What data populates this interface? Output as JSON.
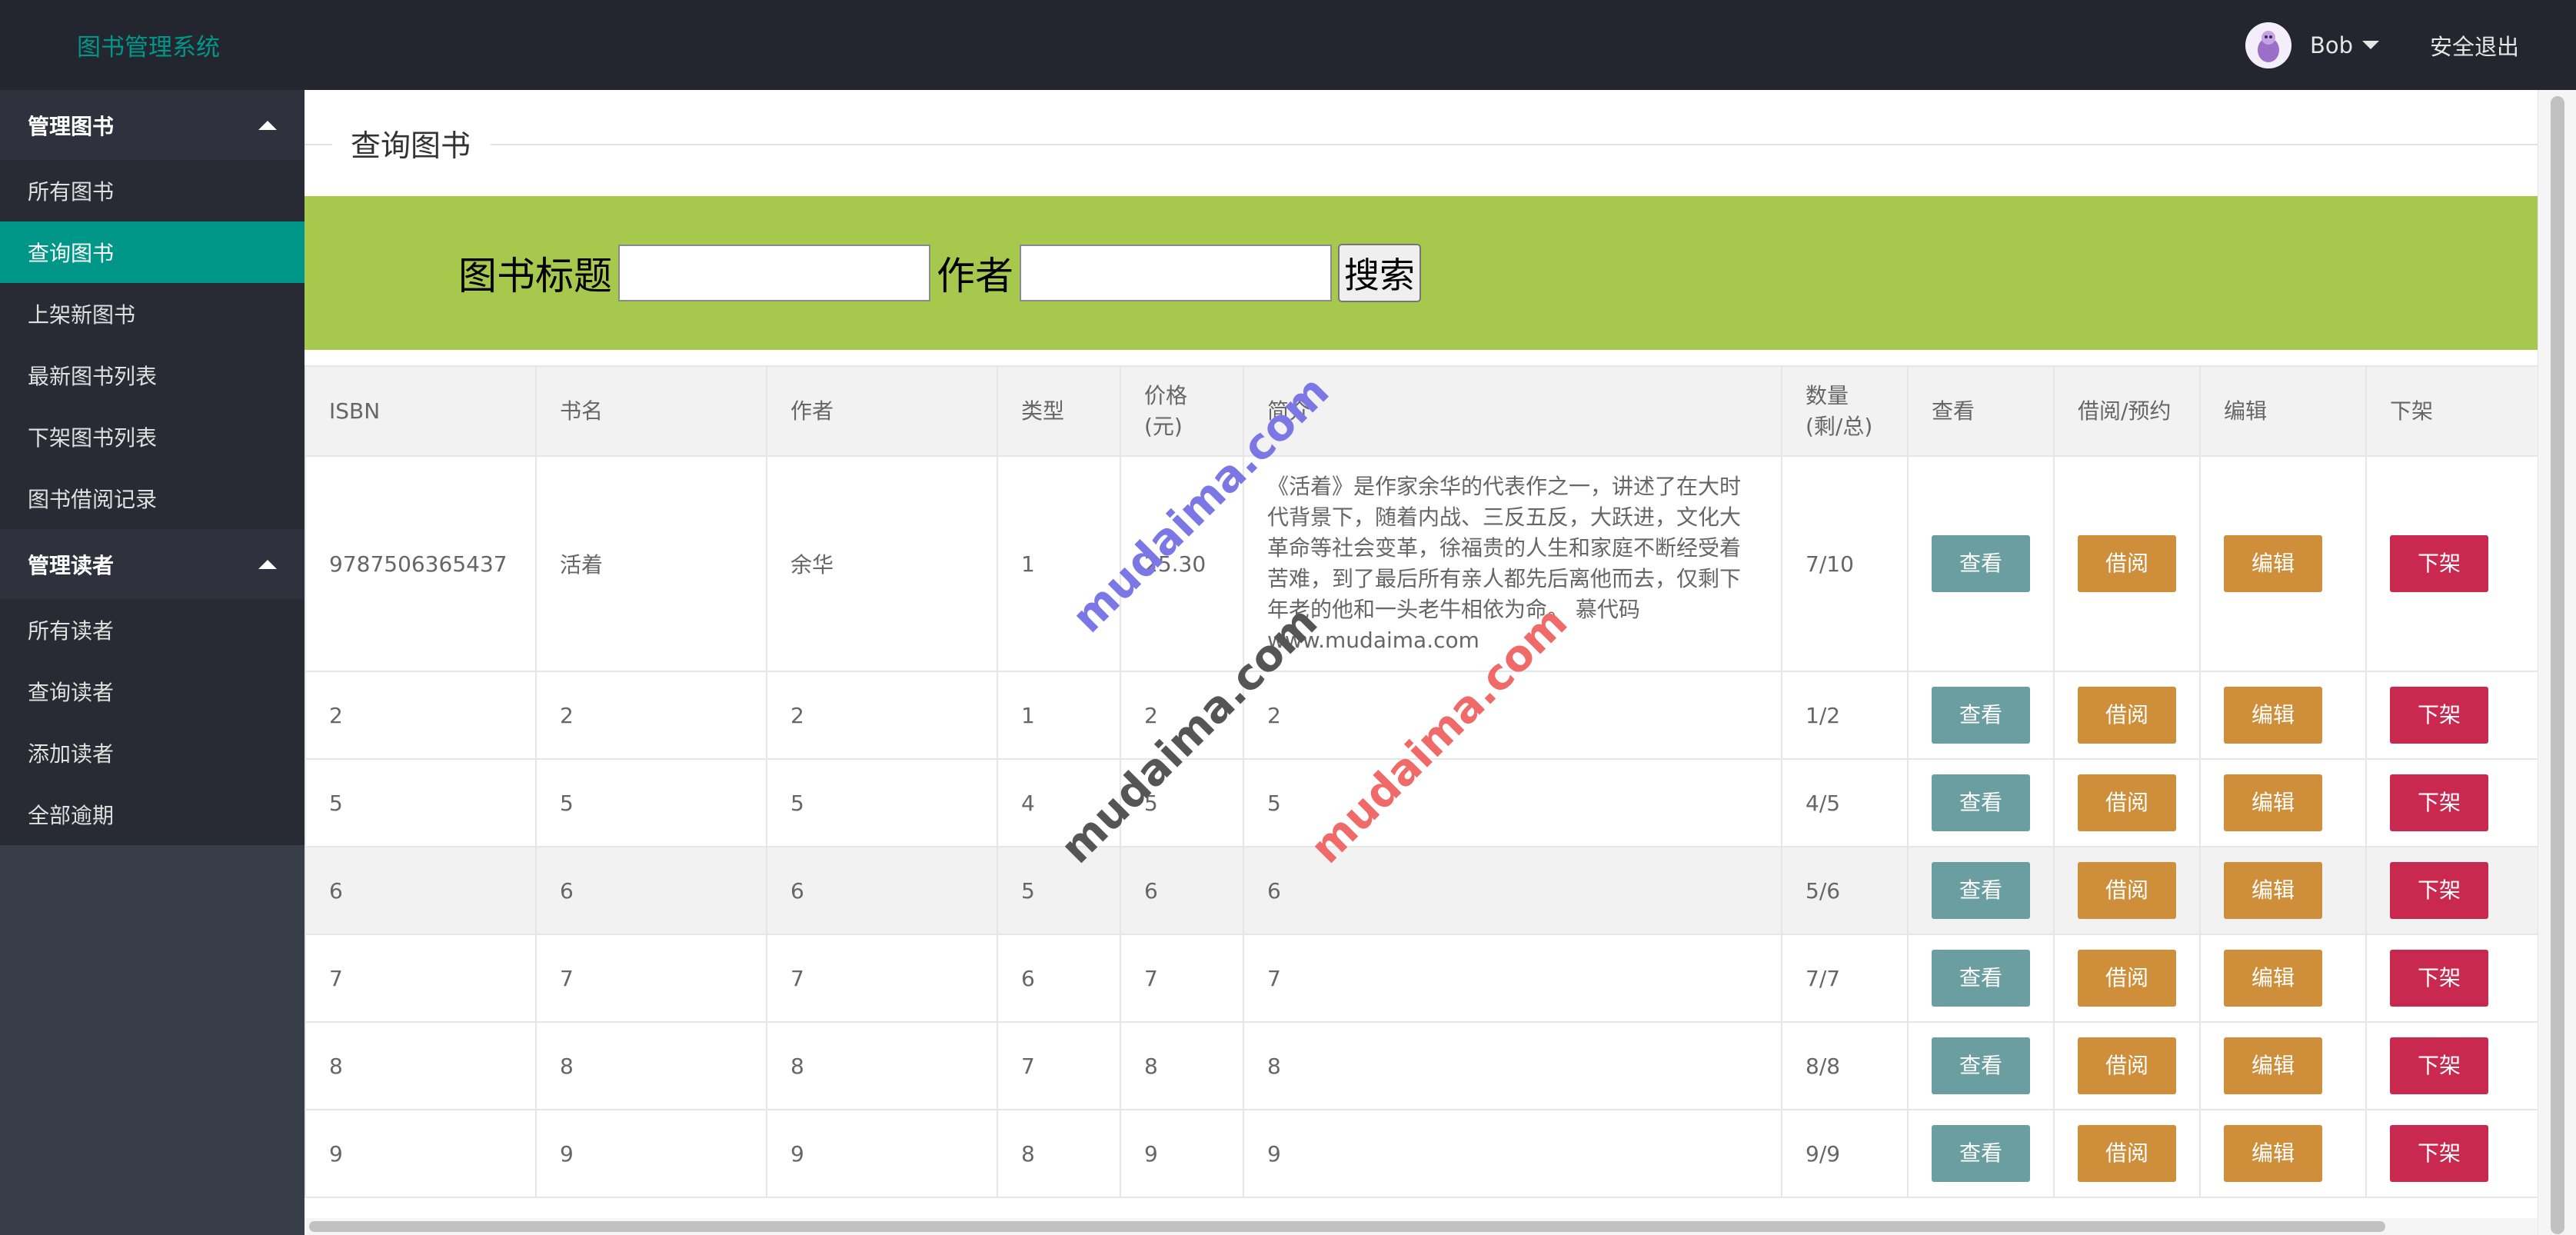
{
  "app": {
    "title": "图书管理系统"
  },
  "header": {
    "user_name": "Bob",
    "logout_label": "安全退出"
  },
  "sidebar": {
    "groups": [
      {
        "label": "管理图书",
        "items": [
          "所有图书",
          "查询图书",
          "上架新图书",
          "最新图书列表",
          "下架图书列表",
          "图书借阅记录"
        ]
      },
      {
        "label": "管理读者",
        "items": [
          "所有读者",
          "查询读者",
          "添加读者",
          "全部逾期"
        ]
      }
    ],
    "active_item": "查询图书"
  },
  "main": {
    "section_title": "查询图书",
    "search": {
      "title_label": "图书标题",
      "title_value": "",
      "author_label": "作者",
      "author_value": "",
      "button_label": "搜索"
    },
    "table": {
      "headers": [
        "ISBN",
        "书名",
        "作者",
        "类型",
        "价格(元)",
        "简介",
        "数量(剩/总)",
        "查看",
        "借阅/预约",
        "编辑",
        "下架"
      ],
      "action_labels": {
        "view": "查看",
        "borrow": "借阅",
        "edit": "编辑",
        "remove": "下架"
      },
      "rows": [
        {
          "isbn": "9787506365437",
          "name": "活着",
          "author": "余华",
          "type": "1",
          "price": "25.30",
          "intro": "《活着》是作家余华的代表作之一，讲述了在大时代背景下，随着内战、三反五反，大跃进，文化大革命等社会变革，徐福贵的人生和家庭不断经受着苦难，到了最后所有亲人都先后离他而去，仅剩下年老的他和一头老牛相依为命。 慕代码www.mudaima.com",
          "count": "7/10"
        },
        {
          "isbn": "2",
          "name": "2",
          "author": "2",
          "type": "1",
          "price": "2",
          "intro": "2",
          "count": "1/2"
        },
        {
          "isbn": "5",
          "name": "5",
          "author": "5",
          "type": "4",
          "price": "5",
          "intro": "5",
          "count": "4/5"
        },
        {
          "isbn": "6",
          "name": "6",
          "author": "6",
          "type": "5",
          "price": "6",
          "intro": "6",
          "count": "5/6"
        },
        {
          "isbn": "7",
          "name": "7",
          "author": "7",
          "type": "6",
          "price": "7",
          "intro": "7",
          "count": "7/7"
        },
        {
          "isbn": "8",
          "name": "8",
          "author": "8",
          "type": "7",
          "price": "8",
          "intro": "8",
          "count": "8/8"
        },
        {
          "isbn": "9",
          "name": "9",
          "author": "9",
          "type": "8",
          "price": "9",
          "intro": "9",
          "count": "9/9"
        }
      ]
    }
  },
  "watermarks": [
    {
      "text": "mudaima.com",
      "color": "#7b78e6"
    },
    {
      "text": "mudaima.com",
      "color": "#555555"
    },
    {
      "text": "mudaima.com",
      "color": "#f06a6a"
    }
  ],
  "colors": {
    "header_bg": "#23262e",
    "sidebar_bg": "#393d49",
    "accent": "#009688",
    "search_bar": "#a6c84c",
    "view_button": "#6a9ea0",
    "borrow_button": "#cf8f3a",
    "edit_button": "#cf8f3a",
    "remove_button": "#c9284f"
  }
}
